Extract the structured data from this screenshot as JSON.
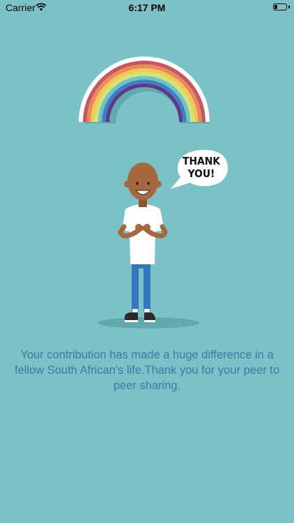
{
  "status_bar": {
    "carrier": "Carrier",
    "time": "6:17 PM",
    "battery_level": 0.25
  },
  "illustration": {
    "speech_bubble": "THANK\nYOU!"
  },
  "message": "Your contribution has made a huge difference in a fellow South African's life.Thank you for your peer to peer sharing.",
  "colors": {
    "background": "#7ac2c6",
    "message_text": "#3e77a8",
    "rainbow": [
      "#c9565c",
      "#e78a5f",
      "#f2c94e",
      "#cfe47a",
      "#6fc3c6",
      "#3f7fc0",
      "#5a3b88"
    ]
  }
}
